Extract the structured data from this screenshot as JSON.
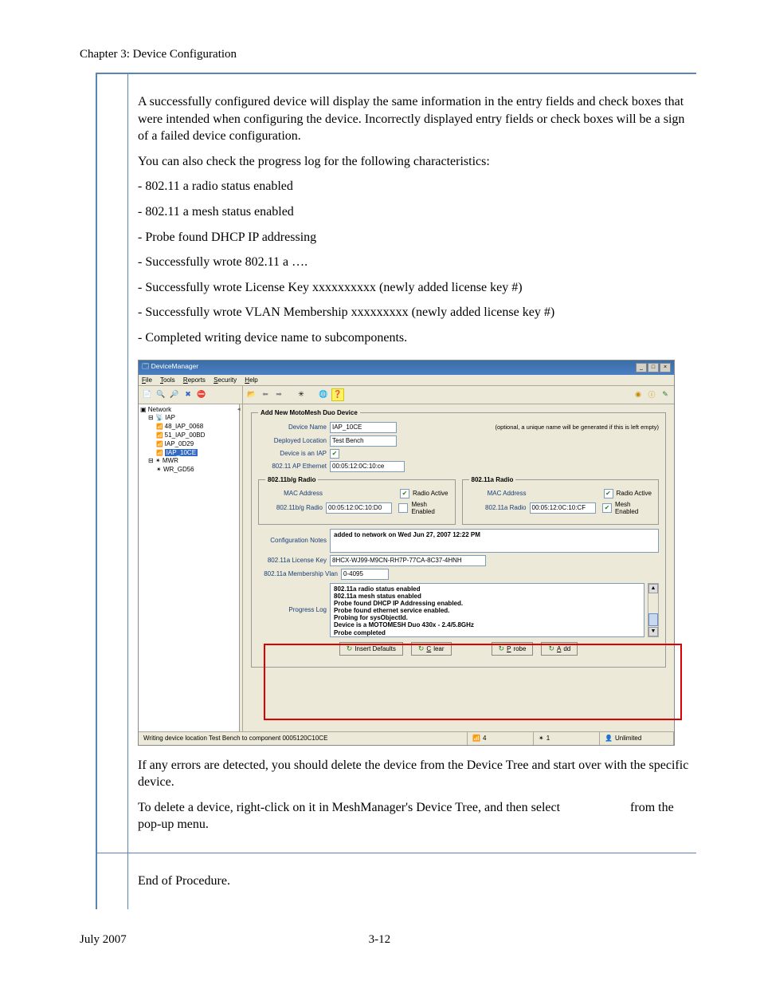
{
  "header": {
    "chapter": "Chapter 3: Device Configuration"
  },
  "body": {
    "p1": "A successfully configured device will display the same information in the entry fields and check boxes that were intended when configuring the device. Incorrectly displayed entry fields or check boxes will be a sign of a failed device configuration.",
    "p2": "You can also check the progress log for the following characteristics:",
    "li1": "- 802.11 a radio status enabled",
    "li2": "- 802.11 a mesh status enabled",
    "li3": " - Probe found DHCP IP addressing",
    "li4": "- Successfully wrote 802.11 a ….",
    "li5": "- Successfully wrote License Key xxxxxxxxxx (newly added license key #)",
    "li6": "- Successfully wrote VLAN Membership xxxxxxxxx (newly added license key #)",
    "li7": "- Completed writing device name to subcomponents.",
    "p3": "If any errors are detected, you should delete the device from the Device Tree and start over with the specific device.",
    "p4a": "To delete a device, right-click on it in MeshManager's Device Tree, and then select ",
    "p4b": " from the pop-up menu.",
    "p5": "End of Procedure."
  },
  "app": {
    "title": "DeviceManager",
    "menu": {
      "file": "File",
      "tools": "Tools",
      "reports": "Reports",
      "security": "Security",
      "help": "Help"
    },
    "tree": {
      "root": "Network",
      "iap": "IAP",
      "d1": "48_IAP_0068",
      "d2": "51_IAP_00BD",
      "d3": "IAP_0D29",
      "d4": "IAP_10CE",
      "mwr": "MWR",
      "d5": "WR_GD56"
    },
    "form": {
      "legend": "Add New MotoMesh Duo Device",
      "device_name_lbl": "Device Name",
      "device_name": "IAP_10CE",
      "device_name_hint": "(optional, a unique name will be generated if this is left empty)",
      "location_lbl": "Deployed Location",
      "location": "Test Bench",
      "is_iap_lbl": "Device is an IAP",
      "ap_eth_lbl": "802.11 AP Ethernet",
      "ap_eth": "00:05:12:0C:10:ce",
      "bg_legend": "802.11b/g Radio",
      "a_legend": "802.11a Radio",
      "mac_lbl": "MAC Address",
      "radio_active": "Radio Active",
      "mesh_enabled": "Mesh Enabled",
      "bg_radio_lbl": "802.11b/g Radio",
      "bg_radio": "00:05:12:0C:10:D0",
      "a_radio_lbl": "802.11a Radio",
      "a_radio": "00:05:12:0C:10:CF",
      "notes_lbl": "Configuration Notes",
      "notes": "added to network on Wed Jun 27, 2007 12:22 PM",
      "lic_lbl": "802.11a License Key",
      "lic": "8HCX-WJ99-M9CN-RH7P-77CA-8C37-4HNH",
      "vlan_lbl": "802.11a Membership Vlan",
      "vlan": "0-4095",
      "log_lbl": "Progress Log",
      "log_l1": "802.11a radio status enabled",
      "log_l2": "802.11a mesh status enabled",
      "log_l3": "Probe found DHCP IP Addressing enabled.",
      "log_l4": "Probe found ethernet service enabled.",
      "log_l5": "Probing for sysObjectId.",
      "log_l6": "Device is a MOTOMESH Duo 430x - 2.4/5.8GHz",
      "log_l7": "Probe completed",
      "btn_defaults": "Insert Defaults",
      "btn_clear": "Clear",
      "btn_probe": "Probe",
      "btn_add": "Add"
    },
    "status": {
      "msg": "Writing device location Test Bench to component 0005120C10CE",
      "c1": "4",
      "c2": "1",
      "c3": "Unlimited"
    }
  },
  "footer": {
    "date": "July 2007",
    "page": "3-12"
  }
}
